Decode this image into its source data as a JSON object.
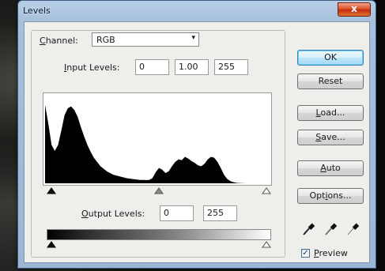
{
  "window": {
    "title": "Levels",
    "close_glyph": "x"
  },
  "channel": {
    "label_u": "C",
    "label_rest": "hannel:",
    "value": "RGB",
    "arrow": "▾"
  },
  "input_levels": {
    "label_u": "I",
    "label_rest": "nput Levels:",
    "black": "0",
    "gamma": "1.00",
    "white": "255"
  },
  "output_levels": {
    "label_u": "O",
    "label_rest": "utput Levels:",
    "black": "0",
    "white": "255"
  },
  "buttons": {
    "ok": "OK",
    "reset": "Reset",
    "load_u": "L",
    "load_rest": "oad...",
    "save_u": "S",
    "save_rest": "ave...",
    "auto_u": "A",
    "auto_rest": "uto",
    "options_pre": "Opt",
    "options_u": "i",
    "options_rest": "ons..."
  },
  "preview": {
    "label_u": "P",
    "label_rest": "review",
    "checked": true,
    "check_glyph": "✓"
  },
  "histogram": {
    "channel": "RGB",
    "profile": [
      0.92,
      0.7,
      0.45,
      0.38,
      0.45,
      0.62,
      0.8,
      0.88,
      0.9,
      0.86,
      0.78,
      0.66,
      0.55,
      0.45,
      0.37,
      0.3,
      0.25,
      0.2,
      0.17,
      0.14,
      0.12,
      0.1,
      0.09,
      0.08,
      0.07,
      0.06,
      0.055,
      0.05,
      0.045,
      0.04,
      0.04,
      0.038,
      0.04,
      0.06,
      0.13,
      0.18,
      0.16,
      0.12,
      0.14,
      0.2,
      0.25,
      0.28,
      0.27,
      0.31,
      0.29,
      0.26,
      0.24,
      0.21,
      0.2,
      0.23,
      0.28,
      0.31,
      0.3,
      0.25,
      0.18,
      0.1,
      0.05,
      0.025,
      0.012,
      0.005,
      0.002,
      0.001,
      0.0,
      0.0,
      0.0,
      0.0,
      0.0,
      0.0,
      0.0,
      0.0
    ]
  },
  "sliders": {
    "input_black": 0,
    "input_gamma": 0.5,
    "input_white": 1,
    "output_black": 0,
    "output_white": 1
  },
  "colors": {
    "accent": "#3c7fb1",
    "histogram_fill": "#000000",
    "close": "#c02d10"
  },
  "icons": {
    "eyedropper_black": "eyedropper-black-icon",
    "eyedropper_gray": "eyedropper-gray-icon",
    "eyedropper_white": "eyedropper-white-icon"
  }
}
